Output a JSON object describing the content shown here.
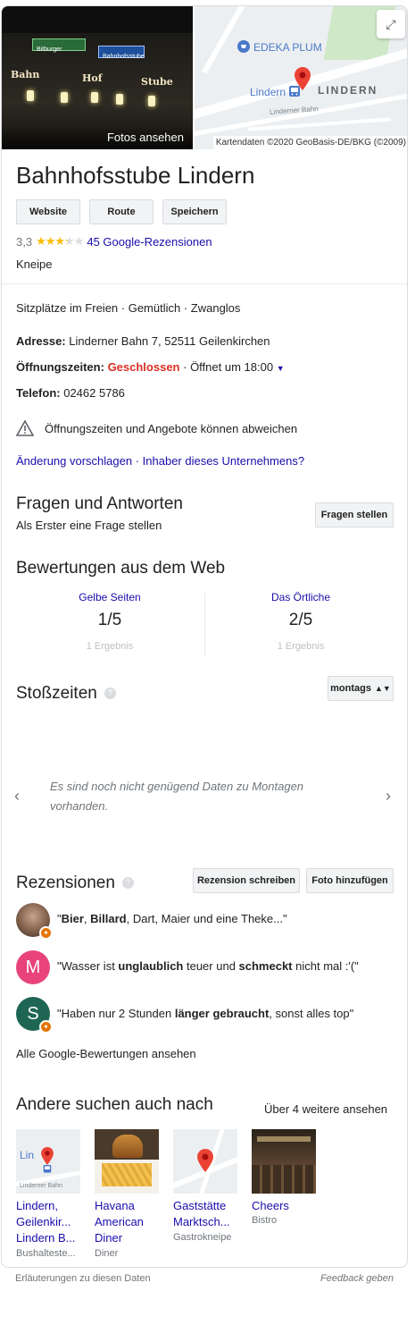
{
  "hero": {
    "photo_label": "Fotos ansehen",
    "photo_signs": [
      "Bitburger",
      "Bahnhofsstube"
    ],
    "photo_words": [
      "Bahn",
      "Hof",
      "Stube"
    ],
    "map_label_poi": "EDEKA PLUM",
    "map_label_place": "Lindern",
    "map_label_town": "LINDERN",
    "map_road_label": "Linderner Bahn",
    "map_credit": "Kartendaten ©2020 GeoBasis-DE/BKG (©2009)",
    "expand_icon": "expand-icon"
  },
  "business": {
    "name": "Bahnhofsstube Lindern",
    "buttons": [
      "Website",
      "Route",
      "Speichern"
    ],
    "rating_value": "3,3",
    "rating_stars": 3.3,
    "reviews_link": "45 Google-Rezensionen",
    "category": "Kneipe"
  },
  "info": {
    "attributes": "Sitzplätze im Freien · Gemütlich · Zwanglos",
    "address_label": "Adresse:",
    "address_value": "Linderner Bahn 7, 52511 Geilenkirchen",
    "hours_label": "Öffnungszeiten:",
    "hours_status": "Geschlossen",
    "hours_next": "· Öffnet um 18:00",
    "phone_label": "Telefon:",
    "phone_value": "02462 5786",
    "warning": "Öffnungszeiten und Angebote können abweichen",
    "suggest_edit": "Änderung vorschlagen",
    "sep": " · ",
    "owner_link": "Inhaber dieses Unternehmens?"
  },
  "qa": {
    "title": "Fragen und Antworten",
    "first_link": "Als Erster eine Frage stellen",
    "ask_button": "Fragen stellen"
  },
  "web_reviews": {
    "title": "Bewertungen aus dem Web",
    "sources": [
      {
        "name": "Gelbe Seiten",
        "score": "1/5",
        "count": "1 Ergebnis"
      },
      {
        "name": "Das Örtliche",
        "score": "2/5",
        "count": "1 Ergebnis"
      }
    ]
  },
  "popular_times": {
    "title": "Stoßzeiten",
    "day_select": "montags",
    "no_data": "Es sind noch nicht genügend Daten zu Montagen vorhanden."
  },
  "reviews": {
    "title": "Rezensionen",
    "write_button": "Rezension schreiben",
    "photo_button": "Foto hinzufügen",
    "items": [
      {
        "avatar": "",
        "avatar_color": "#7a5a46",
        "q_open": "\"",
        "b1": "Bier",
        "t1": ", ",
        "b2": "Billard",
        "t2": ", Dart, Maier und eine Theke...\""
      },
      {
        "avatar": "M",
        "avatar_color": "#e8437a",
        "t0": "\"Wasser ist ",
        "b1": "unglaublich",
        "t1": " teuer und ",
        "b2": "schmeckt",
        "t2": " nicht mal :'(\""
      },
      {
        "avatar": "S",
        "avatar_color": "#1e6653",
        "t0": "\"Haben nur 2 Stunden ",
        "b1": "länger gebraucht",
        "t1": ", sonst alles top\""
      }
    ],
    "all_link": "Alle Google-Bewertungen ansehen"
  },
  "also_search": {
    "title": "Andere suchen auch nach",
    "more_link": "Über 4 weitere ansehen",
    "items": [
      {
        "line1": "Lindern,",
        "line2": "Geilenkir...",
        "line3": "Lindern B...",
        "sub": "Bushalteste...",
        "thumb_label": "Lin",
        "thumb_road": "Linderner Bahn"
      },
      {
        "line1": "Havana",
        "line2": "American",
        "line3": "Diner",
        "sub": "Diner"
      },
      {
        "line1": "Gaststätte",
        "line2": "Marktsch...",
        "line3": "",
        "sub": "Gastrokneipe"
      },
      {
        "line1": "Cheers",
        "line2": "",
        "line3": "",
        "sub": "Bistro"
      }
    ]
  },
  "footer": {
    "left": "Erläuterungen zu diesen Daten",
    "right": "Feedback geben"
  }
}
